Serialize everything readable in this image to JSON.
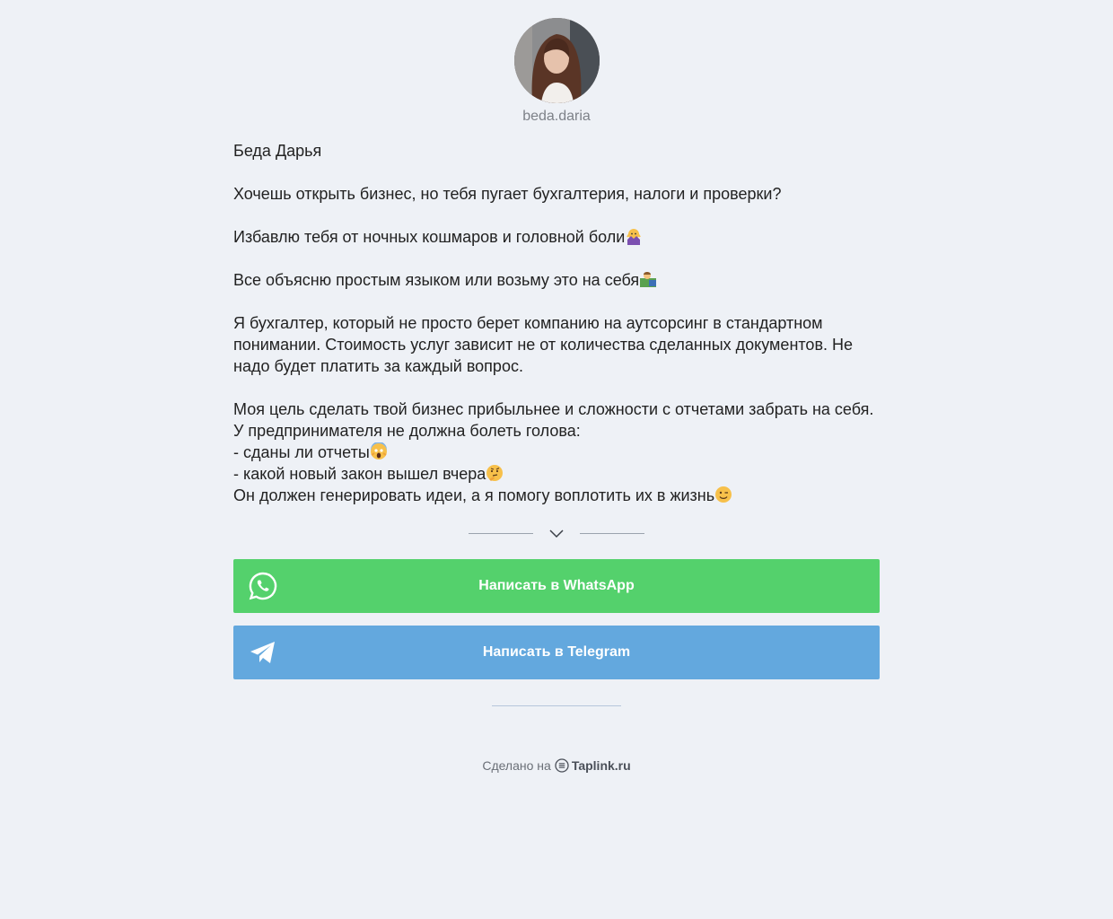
{
  "profile": {
    "username": "beda.daria",
    "avatar_icon": "profile-photo"
  },
  "bio": {
    "name": "Беда Дарья",
    "line1": "Хочешь открыть бизнес, но тебя пугает бухгалтерия, налоги и проверки?",
    "line2": "Избавлю тебя от ночных кошмаров и головной боли",
    "line3": "Все объясню простым языком или возьму это на себя",
    "line4a": "Я бухгалтер, который не просто берет компанию на аутсорсинг в стандартном",
    "line4b": "понимании. Стоимость услуг зависит не от количества сделанных документов. Не",
    "line4c": "надо будет платить за каждый вопрос.",
    "line5a": "Моя цель сделать твой бизнес прибыльнее и сложности с отчетами забрать на себя.",
    "line5b": "У предпринимателя не должна болеть голова:",
    "line5c": "- сданы ли отчеты",
    "line5d": "- какой новый закон вышел вчера",
    "line5e": "Он должен генерировать идеи, а я помогу воплотить их в жизнь"
  },
  "buttons": {
    "whatsapp_label": "Написать в WhatsApp",
    "telegram_label": "Написать в Telegram"
  },
  "footer": {
    "made_on": "Сделано на",
    "brand": "Taplink.ru"
  },
  "colors": {
    "background": "#eef1f6",
    "whatsapp": "#54d16c",
    "telegram": "#63a8de"
  }
}
